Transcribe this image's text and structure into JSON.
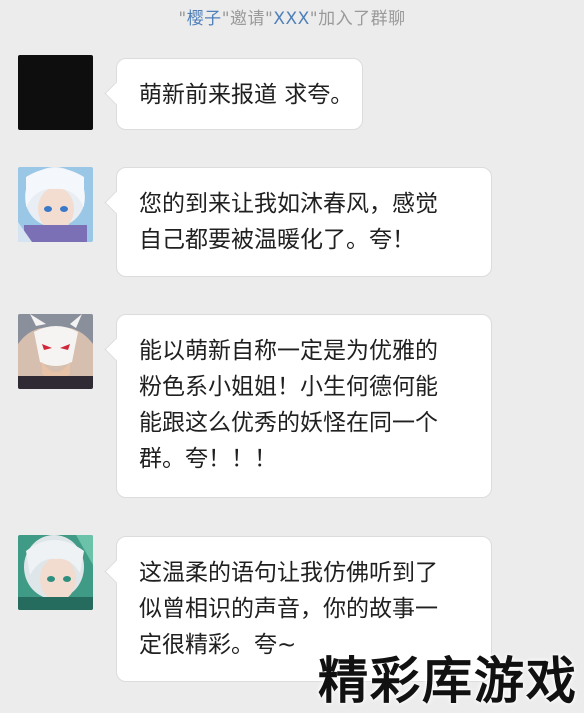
{
  "system_notice": {
    "q1": "\"",
    "inviter": "樱子",
    "q2": "\"",
    "verb": "邀请",
    "q3": "\"",
    "invitee": "XXX",
    "q4": "\"",
    "tail": "加入了群聊"
  },
  "messages": [
    {
      "avatar_icon": "black-square-avatar",
      "lines": [
        "萌新前来报道 求夸。"
      ]
    },
    {
      "avatar_icon": "white-haired-character-avatar",
      "lines": [
        "您的到来让我如沐春风，感觉",
        "自己都要被温暖化了。夸！"
      ]
    },
    {
      "avatar_icon": "fox-mask-character-avatar",
      "lines": [
        "能以萌新自称一定是为优雅的",
        "粉色系小姐姐！小生何德何能",
        "能跟这么优秀的妖怪在同一个",
        "群。夸！！！"
      ]
    },
    {
      "avatar_icon": "silver-haired-character-avatar",
      "lines": [
        "这温柔的语句让我仿佛听到了",
        "似曾相识的声音，你的故事一",
        "定很精彩。夸~"
      ]
    }
  ],
  "watermark": "精彩库游戏",
  "colors": {
    "background": "#ececed",
    "name_link": "#4e7fb9",
    "bubble": "#ffffff"
  }
}
